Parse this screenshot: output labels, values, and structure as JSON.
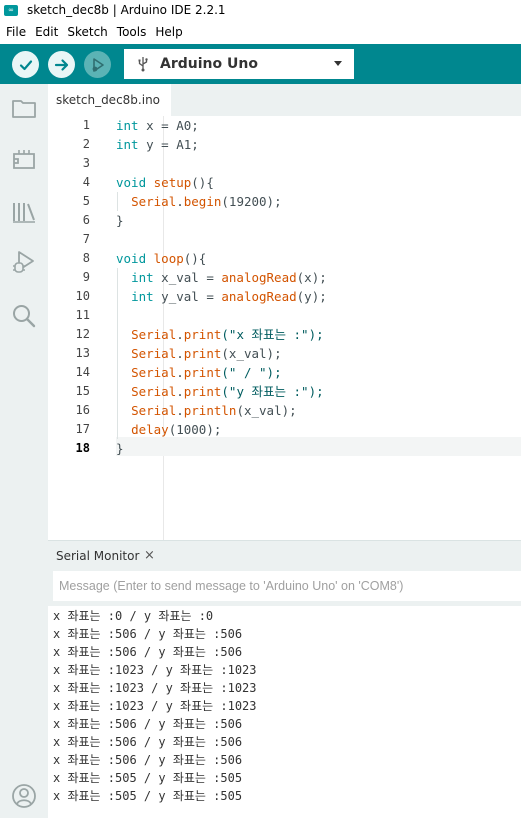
{
  "window": {
    "title": "sketch_dec8b | Arduino IDE 2.2.1"
  },
  "menu": [
    "File",
    "Edit",
    "Sketch",
    "Tools",
    "Help"
  ],
  "toolbar": {
    "board": "Arduino Uno",
    "verify_icon": "check-icon",
    "upload_icon": "arrow-right-icon",
    "debug_icon": "debug-play-icon",
    "accent": "#00878f"
  },
  "sidebar": {
    "icons": [
      "folder-icon",
      "board-manager-icon",
      "library-icon",
      "debug-icon",
      "search-icon",
      "account-icon"
    ]
  },
  "editor": {
    "tab": "sketch_dec8b.ino",
    "active_line": 18,
    "lines": [
      {
        "n": "1",
        "tokens": [
          [
            "kw",
            "int"
          ],
          [
            "plain",
            " x = A0;"
          ]
        ]
      },
      {
        "n": "2",
        "tokens": [
          [
            "kw",
            "int"
          ],
          [
            "plain",
            " y = A1;"
          ]
        ]
      },
      {
        "n": "3",
        "tokens": []
      },
      {
        "n": "4",
        "tokens": [
          [
            "kw",
            "void"
          ],
          [
            "plain",
            " "
          ],
          [
            "fn",
            "setup"
          ],
          [
            "plain",
            "(){"
          ]
        ]
      },
      {
        "n": "5",
        "tokens": [
          [
            "plain",
            "  "
          ],
          [
            "fn",
            "Serial"
          ],
          [
            "plain",
            "."
          ],
          [
            "fn",
            "begin"
          ],
          [
            "plain",
            "(19200);"
          ]
        ]
      },
      {
        "n": "6",
        "tokens": [
          [
            "plain",
            "}"
          ]
        ]
      },
      {
        "n": "7",
        "tokens": []
      },
      {
        "n": "8",
        "tokens": [
          [
            "kw",
            "void"
          ],
          [
            "plain",
            " "
          ],
          [
            "fn",
            "loop"
          ],
          [
            "plain",
            "(){"
          ]
        ]
      },
      {
        "n": "9",
        "tokens": [
          [
            "plain",
            "  "
          ],
          [
            "kw",
            "int"
          ],
          [
            "plain",
            " x_val = "
          ],
          [
            "fn",
            "analogRead"
          ],
          [
            "plain",
            "(x);"
          ]
        ]
      },
      {
        "n": "10",
        "tokens": [
          [
            "plain",
            "  "
          ],
          [
            "kw",
            "int"
          ],
          [
            "plain",
            " y_val = "
          ],
          [
            "fn",
            "analogRead"
          ],
          [
            "plain",
            "(y);"
          ]
        ]
      },
      {
        "n": "11",
        "tokens": []
      },
      {
        "n": "12",
        "tokens": [
          [
            "plain",
            "  "
          ],
          [
            "fn",
            "Serial"
          ],
          [
            "plain",
            "."
          ],
          [
            "fn",
            "print"
          ],
          [
            "str",
            "(\"x 좌표는 :\");"
          ]
        ]
      },
      {
        "n": "13",
        "tokens": [
          [
            "plain",
            "  "
          ],
          [
            "fn",
            "Serial"
          ],
          [
            "plain",
            "."
          ],
          [
            "fn",
            "print"
          ],
          [
            "plain",
            "(x_val);"
          ]
        ]
      },
      {
        "n": "14",
        "tokens": [
          [
            "plain",
            "  "
          ],
          [
            "fn",
            "Serial"
          ],
          [
            "plain",
            "."
          ],
          [
            "fn",
            "print"
          ],
          [
            "str",
            "(\" / \");"
          ]
        ]
      },
      {
        "n": "15",
        "tokens": [
          [
            "plain",
            "  "
          ],
          [
            "fn",
            "Serial"
          ],
          [
            "plain",
            "."
          ],
          [
            "fn",
            "print"
          ],
          [
            "str",
            "(\"y 좌표는 :\");"
          ]
        ]
      },
      {
        "n": "16",
        "tokens": [
          [
            "plain",
            "  "
          ],
          [
            "fn",
            "Serial"
          ],
          [
            "plain",
            "."
          ],
          [
            "fn",
            "println"
          ],
          [
            "plain",
            "(x_val);"
          ]
        ]
      },
      {
        "n": "17",
        "tokens": [
          [
            "plain",
            "  "
          ],
          [
            "fn",
            "delay"
          ],
          [
            "plain",
            "(1000);"
          ]
        ]
      },
      {
        "n": "18",
        "tokens": [
          [
            "plain",
            "}"
          ]
        ]
      }
    ]
  },
  "serial_monitor": {
    "title": "Serial Monitor",
    "close": "×",
    "placeholder": "Message (Enter to send message to 'Arduino Uno' on 'COM8')",
    "output": [
      "x 좌표는 :0 / y 좌표는 :0",
      "x 좌표는 :506 / y 좌표는 :506",
      "x 좌표는 :506 / y 좌표는 :506",
      "x 좌표는 :1023 / y 좌표는 :1023",
      "x 좌표는 :1023 / y 좌표는 :1023",
      "x 좌표는 :1023 / y 좌표는 :1023",
      "x 좌표는 :506 / y 좌표는 :506",
      "x 좌표는 :506 / y 좌표는 :506",
      "x 좌표는 :506 / y 좌표는 :506",
      "x 좌표는 :505 / y 좌표는 :505",
      "x 좌표는 :505 / y 좌표는 :505"
    ]
  }
}
